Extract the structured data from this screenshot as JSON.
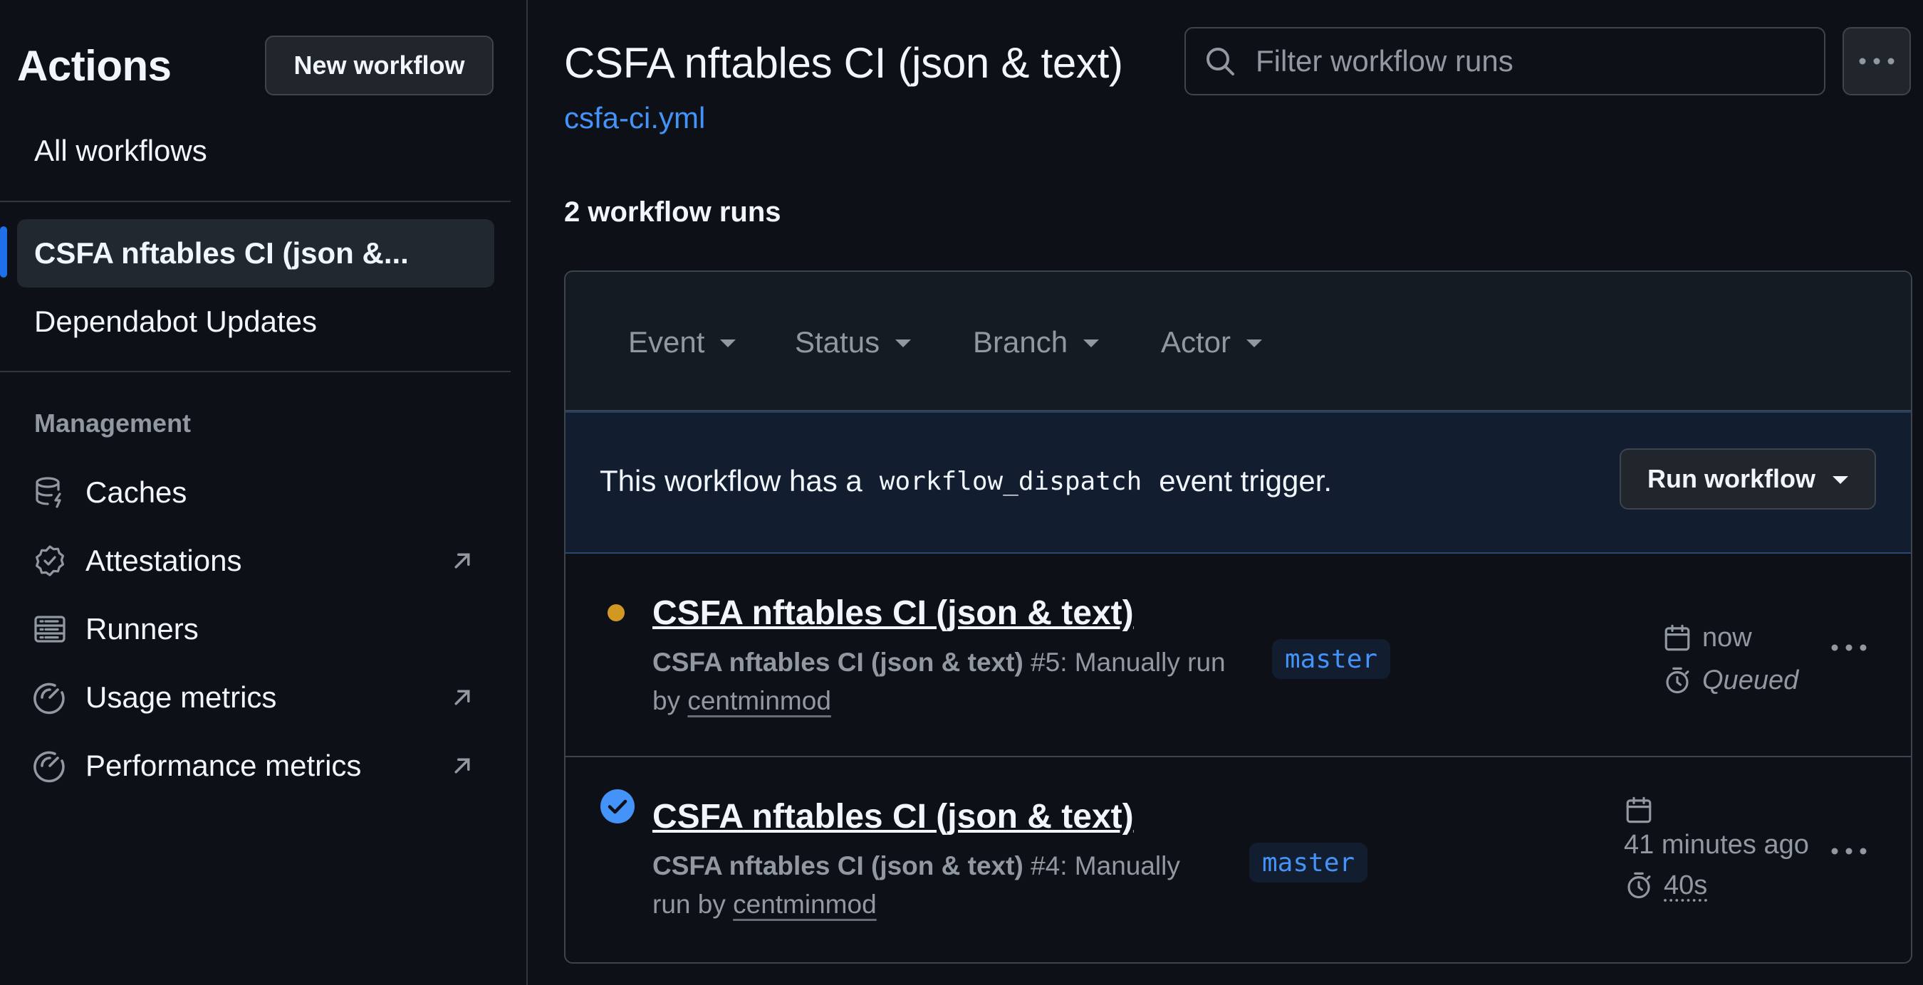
{
  "sidebar": {
    "title": "Actions",
    "new_workflow_label": "New workflow",
    "all_workflows_label": "All workflows",
    "workflows": [
      {
        "label": "CSFA nftables CI (json &...",
        "active": true
      },
      {
        "label": "Dependabot Updates",
        "active": false
      }
    ],
    "management_title": "Management",
    "management_items": [
      {
        "label": "Caches",
        "icon": "database-icon",
        "external": false
      },
      {
        "label": "Attestations",
        "icon": "verified-badge-icon",
        "external": true
      },
      {
        "label": "Runners",
        "icon": "server-icon",
        "external": false
      },
      {
        "label": "Usage metrics",
        "icon": "meter-icon",
        "external": true
      },
      {
        "label": "Performance metrics",
        "icon": "meter-icon",
        "external": true
      }
    ]
  },
  "header": {
    "title": "CSFA nftables CI (json & text)",
    "file": "csfa-ci.yml",
    "search_placeholder": "Filter workflow runs"
  },
  "runs": {
    "count_label": "2 workflow runs",
    "filters": [
      "Event",
      "Status",
      "Branch",
      "Actor"
    ],
    "dispatch": {
      "text_before": "This workflow has a",
      "code": "workflow_dispatch",
      "text_after": "event trigger.",
      "button_label": "Run workflow"
    },
    "items": [
      {
        "status": "queued",
        "status_color": "#d29922",
        "title": "CSFA nftables CI (json & text)",
        "workflow_name": "CSFA nftables CI (json & text)",
        "run_text_line1": "#5: Manually run",
        "run_text_by": "by",
        "actor": "centminmod",
        "branch": "master",
        "time": "now",
        "duration": "Queued"
      },
      {
        "status": "success",
        "status_color": "#4493f8",
        "title": "CSFA nftables CI (json & text)",
        "workflow_name": "CSFA nftables CI (json & text)",
        "run_text_line1": "#4: Manually",
        "run_text_by": "run by",
        "actor": "centminmod",
        "branch": "master",
        "time": "41 minutes ago",
        "duration": "40s"
      }
    ]
  }
}
